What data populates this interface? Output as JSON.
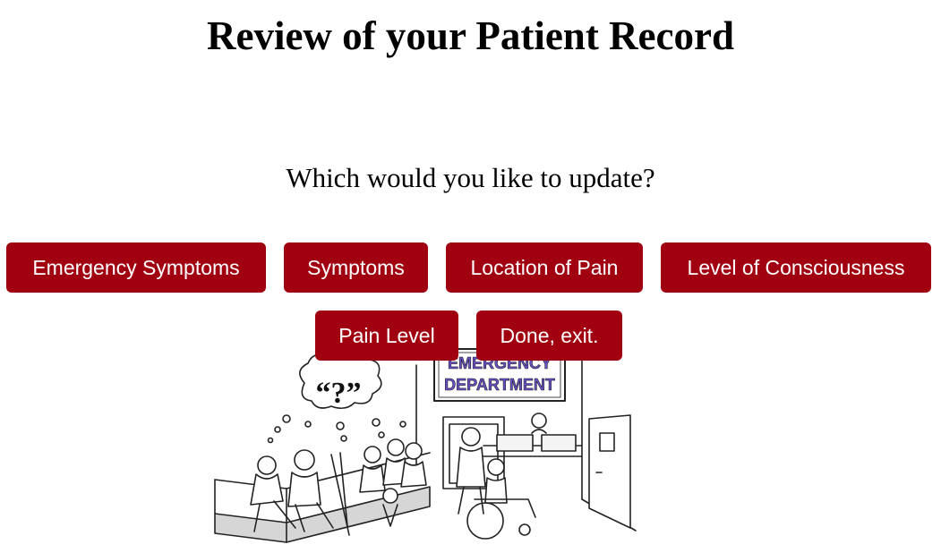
{
  "page": {
    "title": "Review of your Patient Record",
    "prompt": "Which would you like to update?"
  },
  "options": {
    "emergency_symptoms": "Emergency Symptoms",
    "symptoms": "Symptoms",
    "location_of_pain": "Location of Pain",
    "level_of_consciousness": "Level of Consciousness",
    "pain_level": "Pain Level",
    "done_exit": "Done, exit."
  },
  "illustration": {
    "sign_line1": "EMERGENCY",
    "sign_line2": "DEPARTMENT",
    "thought_text": "“?”"
  },
  "colors": {
    "button_background": "#a0000f",
    "button_text": "#ffffff",
    "sign_text": "#6a4fc9"
  }
}
